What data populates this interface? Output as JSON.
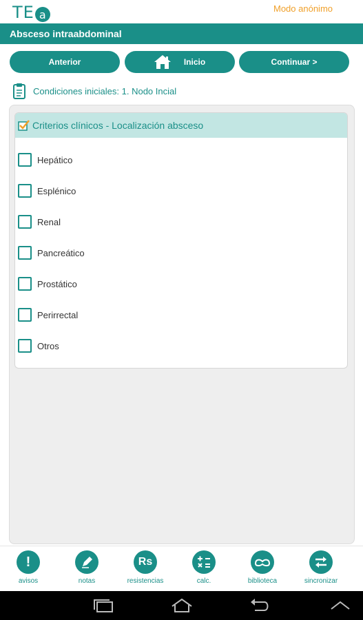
{
  "app": {
    "logo_text": "TE",
    "logo_letter": "a",
    "mode": "Modo anónimo"
  },
  "titlebar": {
    "title": "Absceso intraabdominal"
  },
  "nav": {
    "prev": "Anterior",
    "home": "Inicio",
    "next": "Continuar >"
  },
  "breadcrumb": {
    "text": "Condiciones iniciales: 1. Nodo Incial"
  },
  "section": {
    "title": "Criterios clínicos - Localización absceso",
    "options": [
      "Hepático",
      "Esplénico",
      "Renal",
      "Pancreático",
      "Prostático",
      "Perirrectal",
      "Otros"
    ]
  },
  "toolbar": {
    "items": [
      {
        "label": "avisos",
        "icon": "alert-icon",
        "glyph": "!"
      },
      {
        "label": "notas",
        "icon": "pencil-icon",
        "glyph": ""
      },
      {
        "label": "resistencias",
        "icon": "rs-icon",
        "glyph": "Rs"
      },
      {
        "label": "calc.",
        "icon": "calculator-icon",
        "glyph": ""
      },
      {
        "label": "biblioteca",
        "icon": "library-icon",
        "glyph": ""
      },
      {
        "label": "sincronizar",
        "icon": "sync-icon",
        "glyph": ""
      }
    ]
  },
  "colors": {
    "primary": "#1a8f88",
    "accent": "#f0a02a",
    "header_bg": "#c2e6e3"
  }
}
